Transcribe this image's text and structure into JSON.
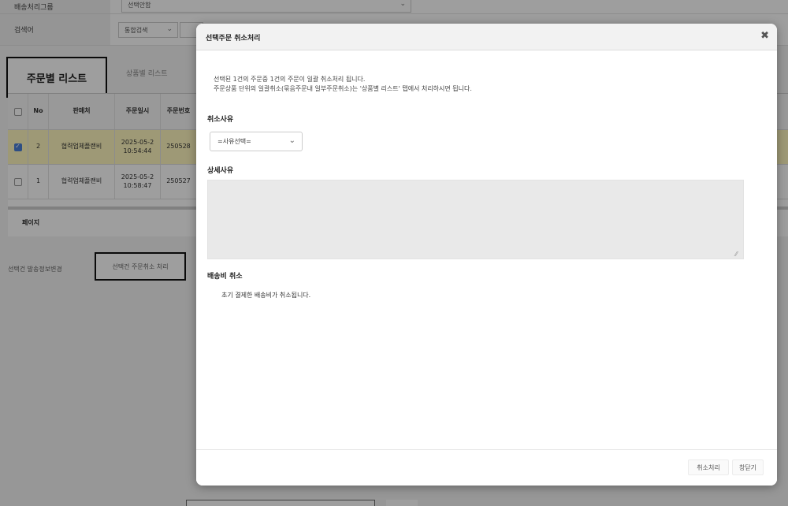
{
  "search_form": {
    "status_label": "배송처리그룹",
    "status_value": "선택안함",
    "keyword_label": "검색어",
    "keyword_type": "통합검색"
  },
  "tabs": {
    "active": "주문별 리스트",
    "inactive": "상품별 리스트"
  },
  "grid": {
    "headers": [
      "No",
      "판매처",
      "주문일시",
      "주문번호"
    ],
    "rows": [
      {
        "checked": true,
        "no": "2",
        "seller": "협력업체플랜비",
        "date": "2025-05-2",
        "time": "10:54:44",
        "order_no": "250528"
      },
      {
        "checked": false,
        "no": "1",
        "seller": "협력업체플랜비",
        "date": "2025-05-2",
        "time": "10:58:47",
        "order_no": "250527"
      }
    ],
    "pager_label": "페이지"
  },
  "actions": {
    "change_shipping": "선택건 발송정보변경",
    "cancel_selected": "선택건 주문취소 처리"
  },
  "modal": {
    "title": "선택주문 취소처리",
    "close_glyph": "✖",
    "info_line1": "선택된 1건의 주문중 1건의 주문이 일괄 취소처리 됩니다.",
    "info_line2": "주문상품 단위의 일괄취소(묶음주문내 일부주문취소)는 '상품별 리스트' 탭에서 처리하시면 됩니다.",
    "reason_label": "취소사유",
    "reason_select_value": "=사유선택=",
    "detail_label": "상세사유",
    "fee_label": "배송비 취소",
    "fee_text": "초기 결제한 배송비가 취소됩니다.",
    "cancel_button": "취소처리",
    "close_button": "창닫기"
  },
  "colors": {
    "highlight_row": "#fff7bf",
    "checkbox_on": "#4b7fd6",
    "overlay": "rgba(0,0,0,0.38)"
  }
}
